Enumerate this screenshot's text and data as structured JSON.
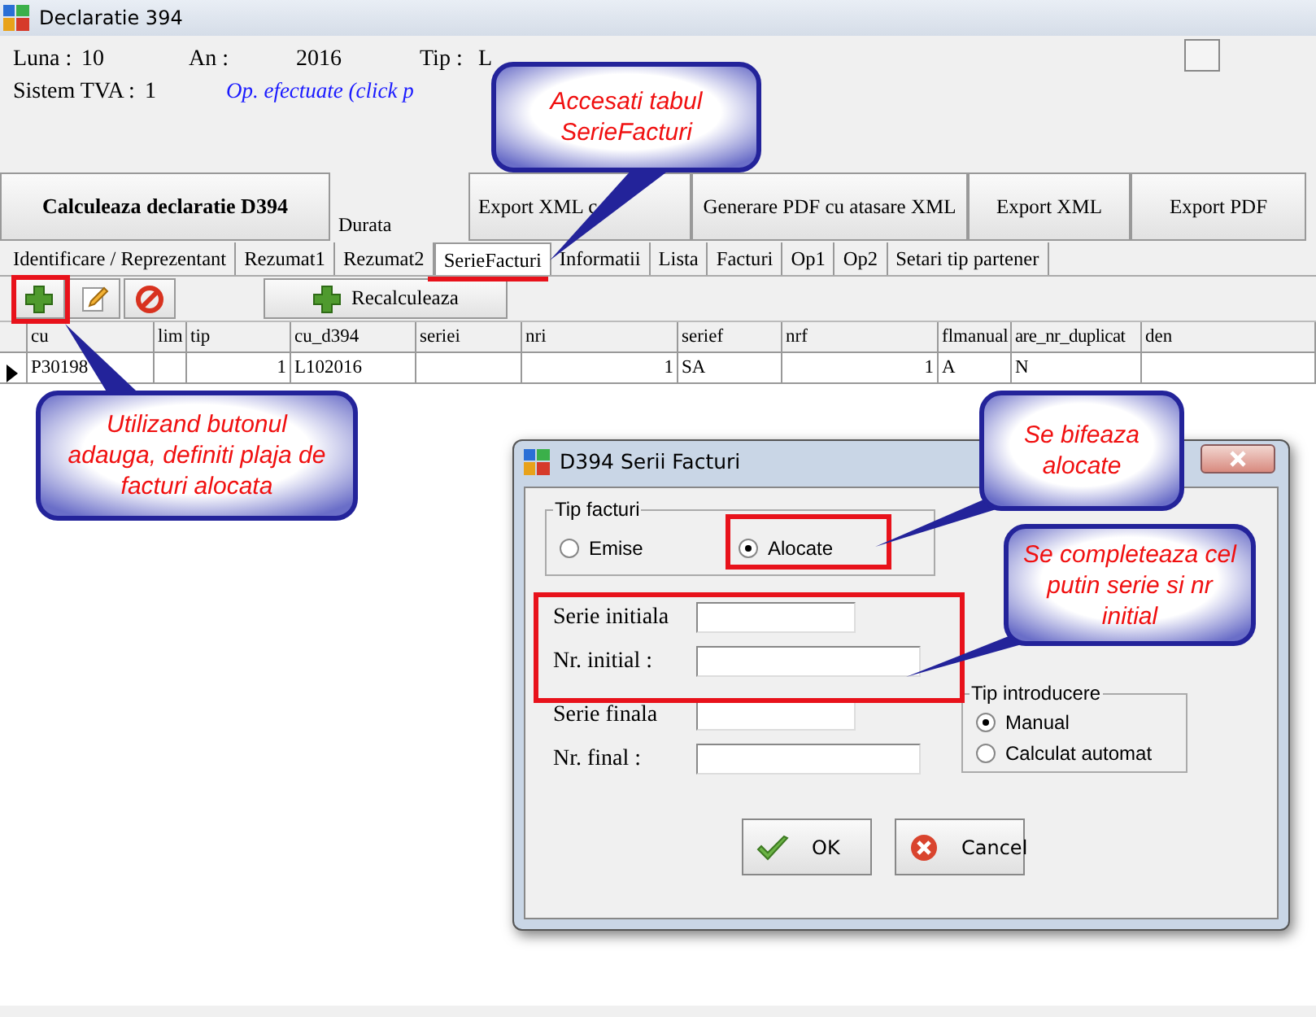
{
  "window": {
    "title": "Declaratie 394"
  },
  "info": {
    "fields": [
      {
        "label": "Luna :",
        "value": "10"
      },
      {
        "label": "An :",
        "value": "2016"
      },
      {
        "label": "Tip :",
        "value": "L"
      }
    ],
    "sistem": {
      "label": "Sistem TVA :",
      "value": "1"
    },
    "link": "Op. efectuate (click p"
  },
  "actions": {
    "main": "Calculeaza declaratie  D394",
    "durata": "Durata",
    "buttons": [
      "Export XML c",
      "Generare PDF cu atasare XML",
      "Export XML",
      "Export PDF"
    ]
  },
  "tabs": [
    {
      "label": "Identificare / Reprezentant",
      "selected": false
    },
    {
      "label": "Rezumat1",
      "selected": false
    },
    {
      "label": "Rezumat2",
      "selected": false
    },
    {
      "label": "SerieFacturi",
      "selected": true
    },
    {
      "label": "Informatii",
      "selected": false
    },
    {
      "label": "Lista",
      "selected": false
    },
    {
      "label": "Facturi",
      "selected": false
    },
    {
      "label": "Op1",
      "selected": false
    },
    {
      "label": "Op2",
      "selected": false
    },
    {
      "label": "Setari tip partener",
      "selected": false
    }
  ],
  "toolbar": {
    "recalc": "Recalculeaza"
  },
  "table": {
    "columns": [
      "cu",
      "lim",
      "tip",
      "cu_d394",
      "seriei",
      "nri",
      "serief",
      "nrf",
      "flmanual",
      "are_nr_duplicat",
      "den"
    ],
    "rows": [
      [
        "P30198",
        "",
        "1",
        "L102016",
        "",
        "1",
        "SA",
        "1",
        "A",
        "N",
        ""
      ]
    ]
  },
  "dialog": {
    "title": "D394 Serii Facturi",
    "group": "Tip facturi",
    "tip_facturi": [
      {
        "label": "Emise",
        "selected": false
      },
      {
        "label": "Alocate",
        "selected": true
      }
    ],
    "fields": [
      {
        "label": "Serie initiala"
      },
      {
        "label": "Nr. initial :"
      },
      {
        "label": "Serie finala"
      },
      {
        "label": "Nr. final :"
      }
    ],
    "group2": "Tip introducere",
    "tip_introducere": [
      {
        "label": "Manual",
        "selected": true
      },
      {
        "label": "Calculat automat",
        "selected": false
      }
    ],
    "buttons": [
      {
        "kind": "ok",
        "label": "OK"
      },
      {
        "kind": "cancel",
        "label": "Cancel"
      }
    ]
  },
  "callouts": [
    "Accesati tabul SerieFacturi",
    "Utilizand butonul adauga, definiti plaja de facturi alocata",
    "Se bifeaza alocate",
    "Se completeaza cel putin serie si nr initial"
  ]
}
